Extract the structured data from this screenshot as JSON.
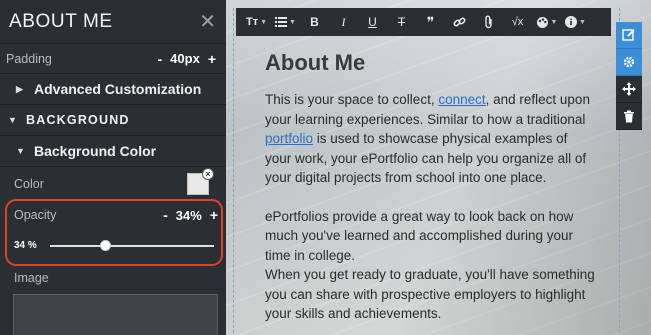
{
  "panel": {
    "title": "ABOUT ME",
    "padding": {
      "label": "Padding",
      "minus": "-",
      "value": "40px",
      "plus": "+"
    },
    "advanced": "Advanced Customization",
    "background": "BACKGROUND",
    "background_color": "Background Color",
    "color_label": "Color",
    "color_value": "#e8e8e8",
    "opacity": {
      "label": "Opacity",
      "minus": "-",
      "value": "34%",
      "plus": "+",
      "slider_label": "34 %",
      "level": 0.34
    },
    "image_label": "Image"
  },
  "editor": {
    "heading": "About Me",
    "links": {
      "connect": "connect",
      "portfolio": "portfolio"
    },
    "p1_a": "This is your space to collect, ",
    "p1_b": ", and reflect upon your learning experiences.  Similar to how a traditional ",
    "p1_c": " is used to showcase physical examples of your work, your ePortfolio can help you organize all of your digital projects from school into one place.",
    "p2": "ePortfolios provide a great way to look back on how much you've learned and accomplished during your time in college.",
    "p3": "When you get ready to graduate, you'll have something you can share with prospective employers to highlight your skills and achievements.",
    "toolbar": {
      "text_size": "Tт",
      "bold": "B",
      "italic": "I",
      "underline": "U",
      "strike": "T",
      "quote": "❞",
      "formula": "√x"
    }
  },
  "colors": {
    "accent_outline": "#d8452a",
    "link": "#2a6fc4",
    "side_tool_active": "#3b8fd9"
  }
}
